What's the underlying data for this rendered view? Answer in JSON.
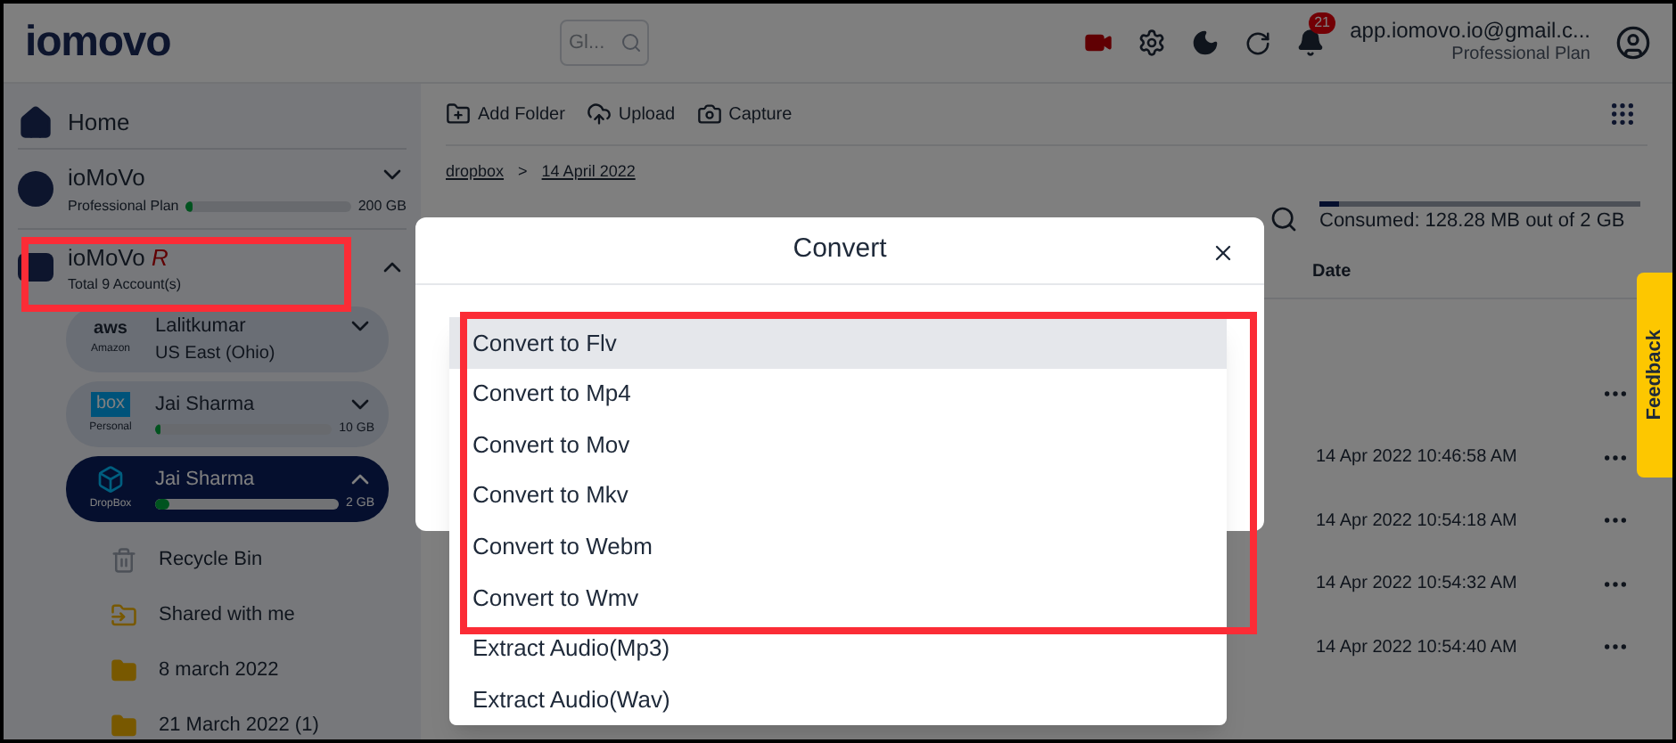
{
  "header": {
    "logo": "iomovo",
    "search": {
      "placeholder": "Gl..."
    },
    "notification_count": "21",
    "account": {
      "email": "app.iomovo.io@gmail.c...",
      "plan": "Professional Plan"
    }
  },
  "sidebar": {
    "home": "Home",
    "plan": {
      "name": "ioMoVo",
      "subtitle": "Professional Plan",
      "level": 0.04,
      "capacity": "200 GB",
      "expanded": false
    },
    "group": {
      "name": "ioMoVo",
      "mark": "R",
      "subtitle": "Total 9 Account(s)",
      "expanded": true
    },
    "accounts": [
      {
        "kind": "aws",
        "logo_text": "aws",
        "provider": "Amazon",
        "name": "Lalitkumar",
        "subtitle": "US East (Ohio)",
        "selected": false,
        "expanded": false
      },
      {
        "kind": "box",
        "logo_text": "box",
        "provider": "Personal",
        "name": "Jai Sharma",
        "level": 0.03,
        "capacity": "10 GB",
        "selected": false,
        "expanded": false
      },
      {
        "kind": "dropbox",
        "provider": "DropBox",
        "name": "Jai Sharma",
        "level": 0.08,
        "capacity": "2 GB",
        "selected": true,
        "expanded": true
      }
    ],
    "folders": [
      {
        "kind": "recycle",
        "label": "Recycle Bin"
      },
      {
        "kind": "shared",
        "label": "Shared with me"
      },
      {
        "kind": "folder",
        "label": "8 march 2022"
      },
      {
        "kind": "folder",
        "label": "21 March 2022 (1)"
      }
    ]
  },
  "main": {
    "toolbar": [
      {
        "kind": "folder",
        "label": "Add Folder"
      },
      {
        "kind": "upload",
        "label": "Upload"
      },
      {
        "kind": "camera",
        "label": "Capture"
      }
    ],
    "breadcrumb": [
      "dropbox",
      "14 April 2022"
    ],
    "breadcrumb_separator": ">",
    "storage": {
      "text": "Consumed: 128.28 MB out of 2 GB",
      "level": 0.06
    },
    "table": {
      "columns": [
        {
          "label": "Date"
        }
      ],
      "rows": [
        {},
        {
          "date": "14 Apr 2022 10:46:58 AM"
        },
        {
          "date": "14 Apr 2022 10:54:18 AM"
        },
        {
          "date": "14 Apr 2022 10:54:32 AM"
        },
        {
          "date": "14 Apr 2022 10:54:40 AM"
        }
      ]
    }
  },
  "feedback": "Feedback",
  "modal": {
    "title": "Convert",
    "options": [
      {
        "label": "Convert to Flv",
        "selected": true
      },
      {
        "label": "Convert to Mp4",
        "selected": false
      },
      {
        "label": "Convert to Mov",
        "selected": false
      },
      {
        "label": "Convert to Mkv",
        "selected": false
      },
      {
        "label": "Convert to Webm",
        "selected": false
      },
      {
        "label": "Convert to Wmv",
        "selected": false
      },
      {
        "label": "Extract Audio(Mp3)",
        "selected": false
      },
      {
        "label": "Extract Audio(Wav)",
        "selected": false
      }
    ]
  }
}
